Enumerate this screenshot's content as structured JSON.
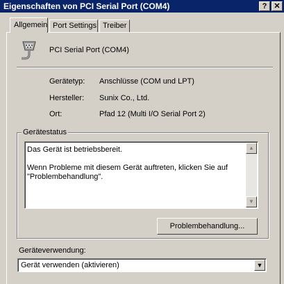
{
  "window": {
    "title": "Eigenschaften von PCI Serial Port (COM4)",
    "help_label": "?",
    "close_label": "✕"
  },
  "tabs": [
    {
      "label": "Allgemein",
      "active": true
    },
    {
      "label": "Port Settings",
      "active": false
    },
    {
      "label": "Treiber",
      "active": false
    }
  ],
  "device": {
    "icon": "serial-port-icon",
    "name": "PCI Serial Port (COM4)"
  },
  "properties": {
    "type_label": "Gerätetyp:",
    "type_value": "Anschlüsse (COM und LPT)",
    "manufacturer_label": "Hersteller:",
    "manufacturer_value": "Sunix Co., Ltd.",
    "location_label": "Ort:",
    "location_value": "Pfad 12 (Multi I/O Serial Port 2)"
  },
  "status": {
    "group_title": "Gerätestatus",
    "line1": "Das Gerät ist betriebsbereit.",
    "line2": "Wenn Probleme mit diesem Gerät auftreten, klicken Sie auf \"Problembehandlung\".",
    "troubleshoot_button": "Problembehandlung..."
  },
  "usage": {
    "label": "Geräteverwendung:",
    "selected": "Gerät verwenden (aktivieren)"
  }
}
